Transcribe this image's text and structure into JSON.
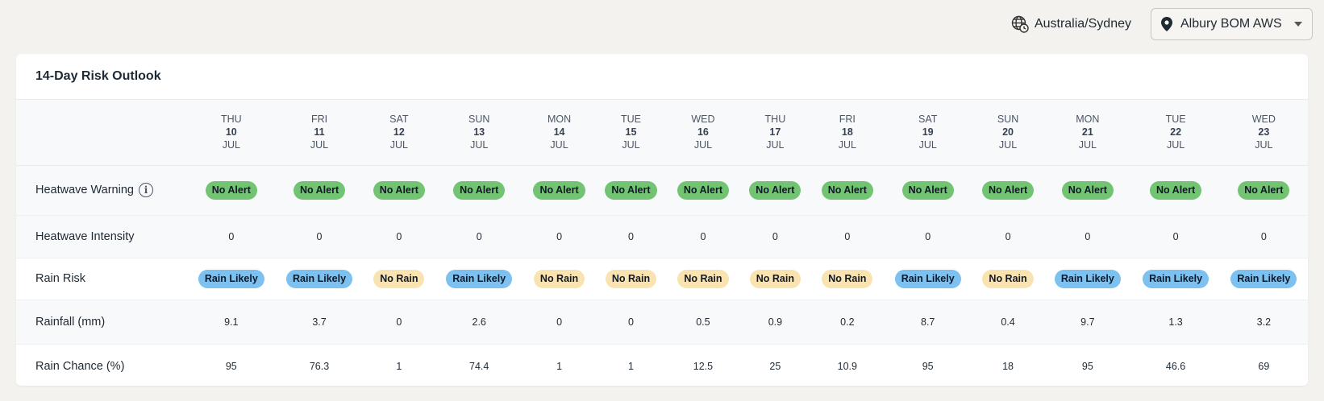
{
  "timezone": {
    "label": "Australia/Sydney",
    "icon": "globe-clock-icon"
  },
  "station": {
    "label": "Albury BOM AWS",
    "icon": "map-pin-icon"
  },
  "card": {
    "title": "14-Day Risk Outlook"
  },
  "days": [
    {
      "dow": "THU",
      "date": "10",
      "month": "JUL"
    },
    {
      "dow": "FRI",
      "date": "11",
      "month": "JUL"
    },
    {
      "dow": "SAT",
      "date": "12",
      "month": "JUL"
    },
    {
      "dow": "SUN",
      "date": "13",
      "month": "JUL"
    },
    {
      "dow": "MON",
      "date": "14",
      "month": "JUL"
    },
    {
      "dow": "TUE",
      "date": "15",
      "month": "JUL"
    },
    {
      "dow": "WED",
      "date": "16",
      "month": "JUL"
    },
    {
      "dow": "THU",
      "date": "17",
      "month": "JUL"
    },
    {
      "dow": "FRI",
      "date": "18",
      "month": "JUL"
    },
    {
      "dow": "SAT",
      "date": "19",
      "month": "JUL"
    },
    {
      "dow": "SUN",
      "date": "20",
      "month": "JUL"
    },
    {
      "dow": "MON",
      "date": "21",
      "month": "JUL"
    },
    {
      "dow": "TUE",
      "date": "22",
      "month": "JUL"
    },
    {
      "dow": "WED",
      "date": "23",
      "month": "JUL"
    }
  ],
  "rows": {
    "heatwave_warning": {
      "label": "Heatwave Warning",
      "info_icon": "info-icon",
      "values": [
        "No Alert",
        "No Alert",
        "No Alert",
        "No Alert",
        "No Alert",
        "No Alert",
        "No Alert",
        "No Alert",
        "No Alert",
        "No Alert",
        "No Alert",
        "No Alert",
        "No Alert",
        "No Alert"
      ]
    },
    "heatwave_intensity": {
      "label": "Heatwave Intensity",
      "values": [
        "0",
        "0",
        "0",
        "0",
        "0",
        "0",
        "0",
        "0",
        "0",
        "0",
        "0",
        "0",
        "0",
        "0"
      ]
    },
    "rain_risk": {
      "label": "Rain Risk",
      "values": [
        "Rain Likely",
        "Rain Likely",
        "No Rain",
        "Rain Likely",
        "No Rain",
        "No Rain",
        "No Rain",
        "No Rain",
        "No Rain",
        "Rain Likely",
        "No Rain",
        "Rain Likely",
        "Rain Likely",
        "Rain Likely"
      ]
    },
    "rainfall": {
      "label": "Rainfall (mm)",
      "values": [
        "9.1",
        "3.7",
        "0",
        "2.6",
        "0",
        "0",
        "0.5",
        "0.9",
        "0.2",
        "8.7",
        "0.4",
        "9.7",
        "1.3",
        "3.2"
      ]
    },
    "rain_chance": {
      "label": "Rain Chance (%)",
      "values": [
        "95",
        "76.3",
        "1",
        "74.4",
        "1",
        "1",
        "12.5",
        "25",
        "10.9",
        "95",
        "18",
        "95",
        "46.6",
        "69"
      ]
    }
  },
  "colors": {
    "no_alert": "#72c472",
    "rain_likely": "#7cc1f0",
    "no_rain": "#f9e3b0"
  }
}
